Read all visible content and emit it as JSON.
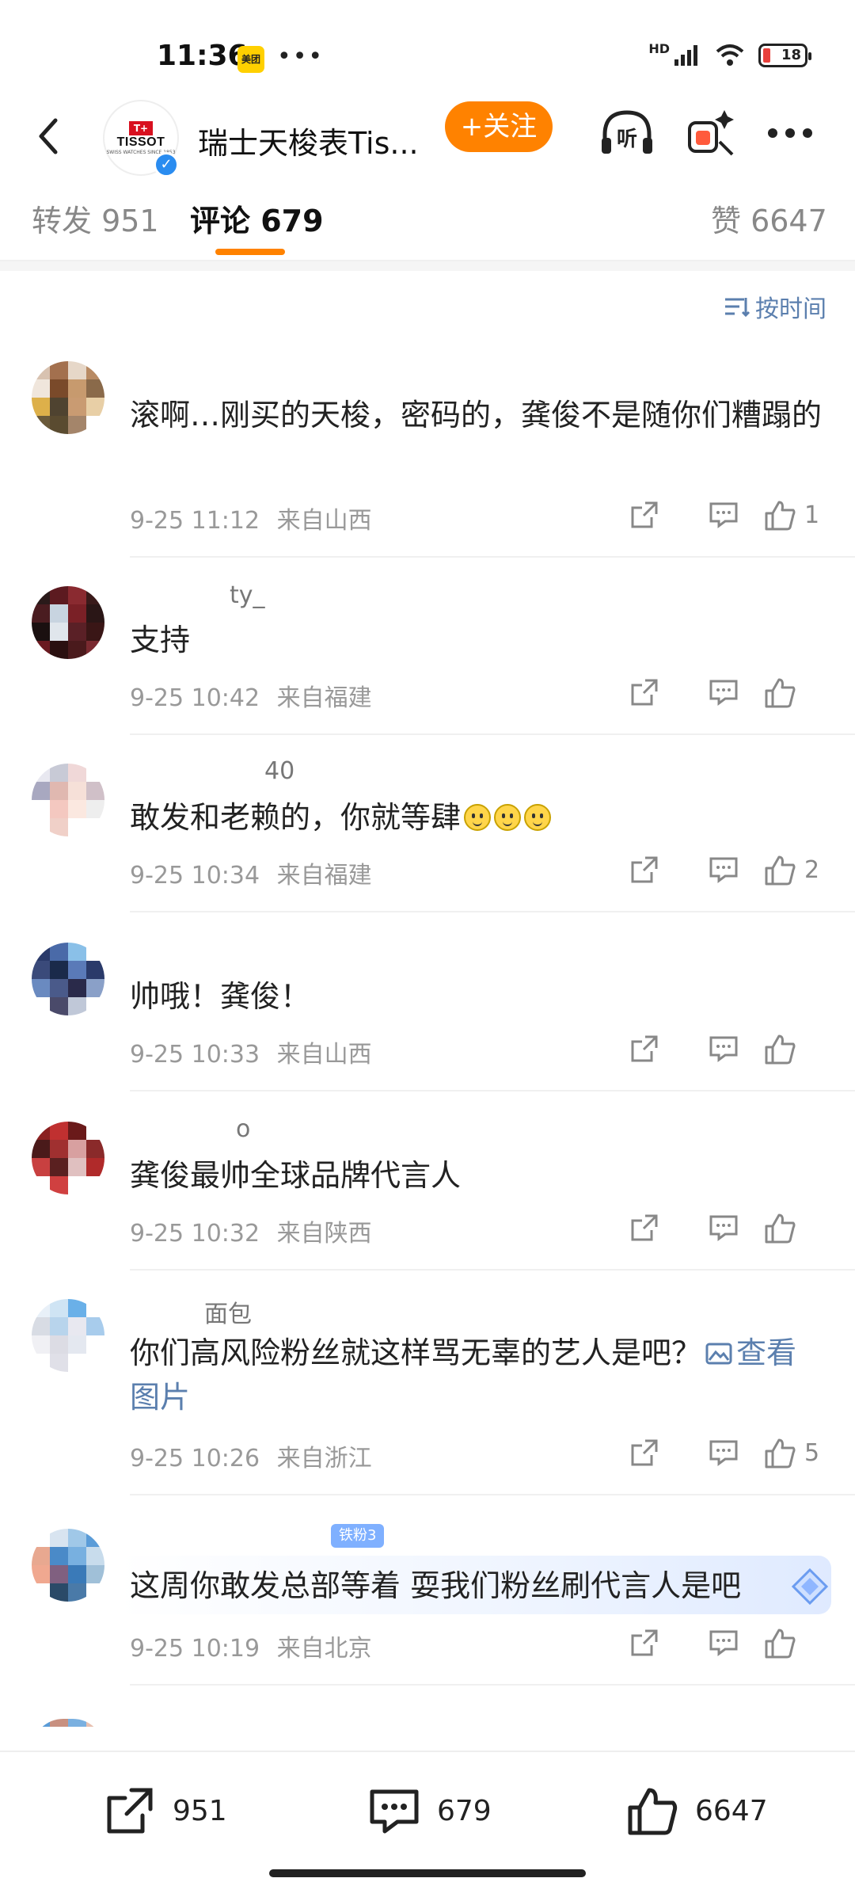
{
  "status_bar": {
    "time": "11:36",
    "app_badge": "美团",
    "dots": "•••",
    "battery": "18",
    "network": "HD"
  },
  "header": {
    "title": "瑞士天梭表Tis...",
    "follow_label": "+关注",
    "brand_mark": "T+",
    "brand_word": "TISSOT",
    "brand_sub": "SWISS WATCHES SINCE 1853",
    "listen_label": "听"
  },
  "tabs": [
    {
      "label": "转发 951"
    },
    {
      "label": "评论 679"
    },
    {
      "label": "赞 6647"
    }
  ],
  "sort_label": "按时间",
  "comments": [
    {
      "name": "",
      "text": "滚啊…刚买的天梭，密码的，龚俊不是随你们糟蹋的",
      "time": "9-25 11:12",
      "location": "来自山西",
      "likes": "1"
    },
    {
      "name": "ty_",
      "text": "支持",
      "time": "9-25 10:42",
      "location": "来自福建",
      "likes": ""
    },
    {
      "name": "40",
      "text": "敢发和老赖的，你就等肆",
      "time": "9-25 10:34",
      "location": "来自福建",
      "likes": "2"
    },
    {
      "name": "",
      "text": "帅哦！龚俊！",
      "time": "9-25 10:33",
      "location": "来自山西",
      "likes": ""
    },
    {
      "name": "o",
      "text": "龚俊最帅全球品牌代言人",
      "time": "9-25 10:32",
      "location": "来自陕西",
      "likes": ""
    },
    {
      "name": "面包",
      "text": "你们高风险粉丝就这样骂无辜的艺人是吧？",
      "link": "查看图片",
      "time": "9-25 10:26",
      "location": "来自浙江",
      "likes": "5"
    },
    {
      "name": "",
      "badge": "铁粉3",
      "text": "这周你敢发总部等着 耍我们粉丝刷代言人是吧",
      "time": "9-25 10:19",
      "location": "来自北京",
      "likes": ""
    }
  ],
  "bottom_bar": {
    "repost_count": "951",
    "comment_count": "679",
    "like_count": "6647"
  },
  "colors": {
    "accent": "#ff8200",
    "link": "#5b7fae",
    "verified": "#2a8cf0"
  }
}
